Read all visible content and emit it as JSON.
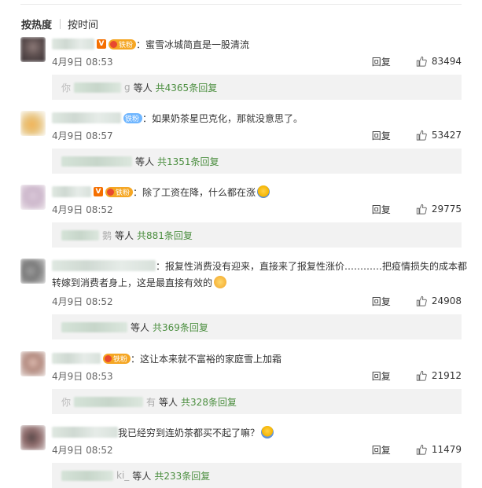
{
  "sort_tabs": {
    "hot": "按热度",
    "time": "按时间"
  },
  "reply_label": "回复",
  "sub_suffix": "等人",
  "comments": [
    {
      "text": "蜜雪冰城简直是一股清流",
      "badge": "铁粉",
      "verified": "V",
      "time": "4月9日 08:53",
      "likes": "83494",
      "sub_count": "共4365条回复",
      "sub_prefix": "你",
      "sub_tail": "g"
    },
    {
      "text": "如果奶茶星巴克化，那就没意思了。",
      "badge": "铁粉",
      "time": "4月9日 08:57",
      "likes": "53427",
      "sub_count": "共1351条回复"
    },
    {
      "text": "除了工资在降，什么都在涨",
      "badge": "铁粉",
      "verified": "V",
      "time": "4月9日 08:52",
      "likes": "29775",
      "sub_count": "共881条回复",
      "sub_tail": "鹅"
    },
    {
      "text_line1": "报复性消费没有迎来，直接来了报复性涨价…………把疫情损失的成本都",
      "text_line2": "转嫁到消费者身上，这是最直接有效的",
      "time": "4月9日 08:52",
      "likes": "24908",
      "sub_count": "共369条回复"
    },
    {
      "text": "这让本来就不富裕的家庭雪上加霜",
      "badge": "铁粉",
      "time": "4月9日 08:53",
      "likes": "21912",
      "sub_count": "共328条回复",
      "sub_prefix": "你",
      "sub_tail": "有"
    },
    {
      "text": "我已经穷到连奶茶都买不起了嘛？",
      "time": "4月9日 08:52",
      "likes": "11479",
      "sub_count": "共233条回复",
      "sub_tail": "ki_"
    }
  ]
}
